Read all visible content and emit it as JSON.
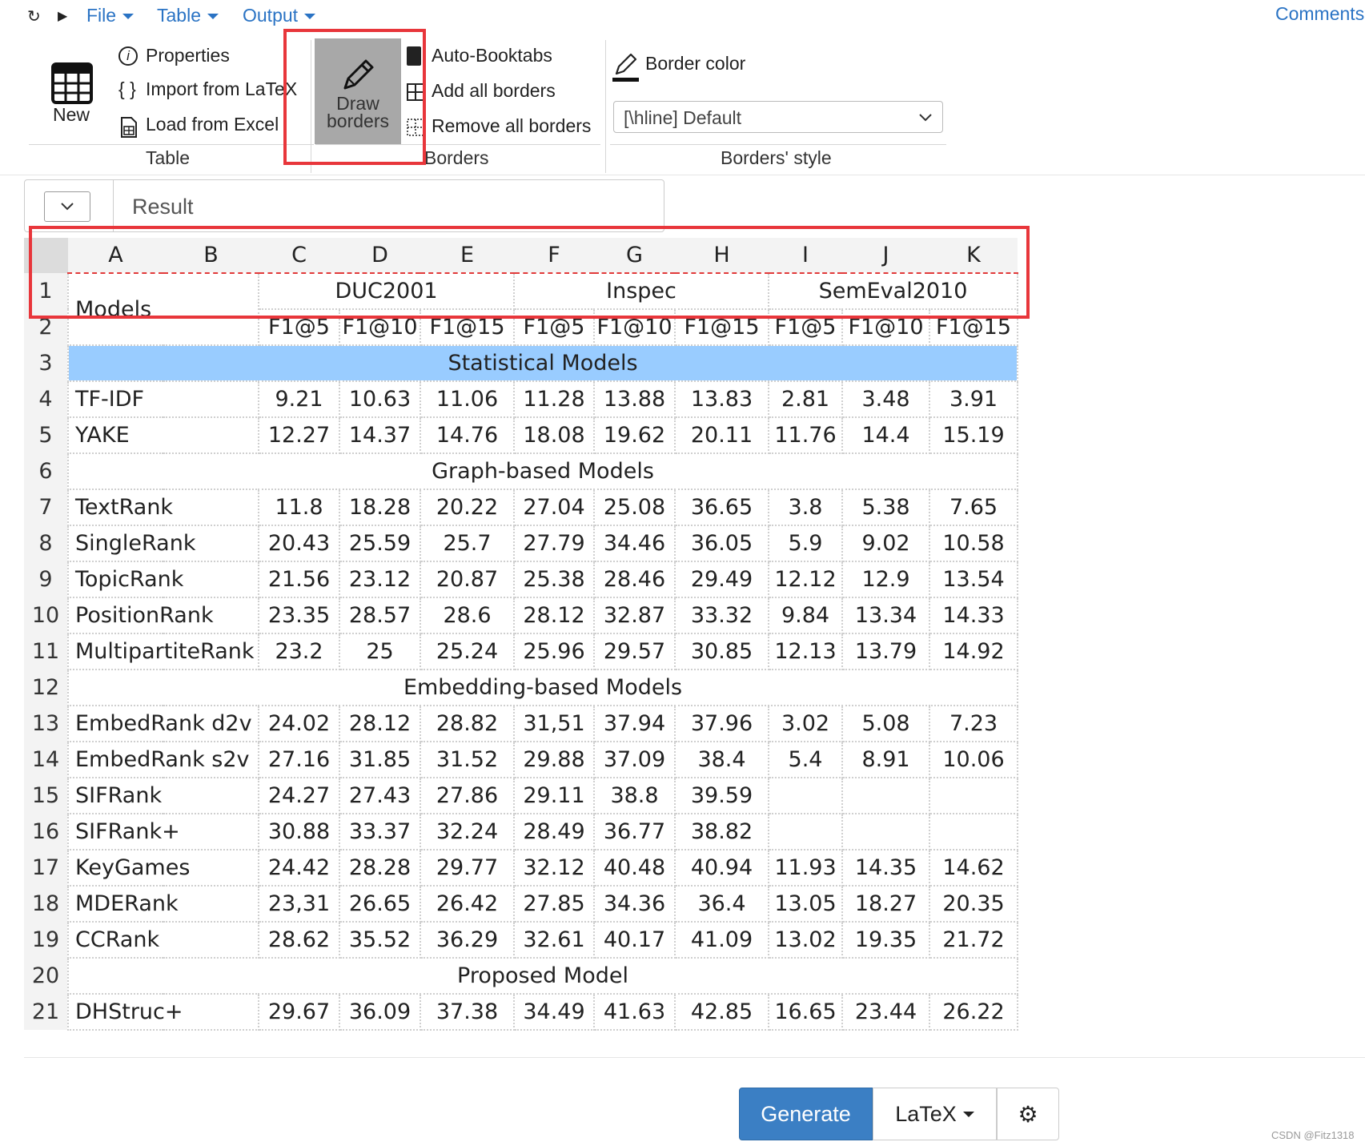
{
  "menu": {
    "file": "File",
    "table": "Table",
    "output": "Output",
    "comments": "Comments"
  },
  "ribbon": {
    "new_label": "New",
    "properties": "Properties",
    "import_latex": "Import from LaTeX",
    "load_excel": "Load from Excel",
    "group_table": "Table",
    "draw_borders_line1": "Draw",
    "draw_borders_line2": "borders",
    "auto_booktabs": "Auto-Booktabs",
    "add_all_borders": "Add all borders",
    "remove_all_borders": "Remove all borders",
    "group_borders": "Borders",
    "border_color": "Border color",
    "border_style_value": "[\\hline] Default",
    "group_borders_style": "Borders' style"
  },
  "result_bar": {
    "label": "Result"
  },
  "grid": {
    "columns": [
      "A",
      "B",
      "C",
      "D",
      "E",
      "F",
      "G",
      "H",
      "I",
      "J",
      "K"
    ],
    "header1": {
      "models": "Models",
      "duc": "DUC2001",
      "inspec": "Inspec",
      "semeval": "SemEval2010"
    },
    "header2": [
      "F1@5",
      "F1@10",
      "F1@15",
      "F1@5",
      "F1@10",
      "F1@15",
      "F1@5",
      "F1@10",
      "F1@15"
    ],
    "sections": {
      "r3": "Statistical Models",
      "r6": "Graph-based Models",
      "r12": "Embedding-based Models",
      "r20": "Proposed Model"
    },
    "data_rows": [
      {
        "row": "4",
        "name": "TF-IDF",
        "values": [
          "9.21",
          "10.63",
          "11.06",
          "11.28",
          "13.88",
          "13.83",
          "2.81",
          "3.48",
          "3.91"
        ]
      },
      {
        "row": "5",
        "name": "YAKE",
        "values": [
          "12.27",
          "14.37",
          "14.76",
          "18.08",
          "19.62",
          "20.11",
          "11.76",
          "14.4",
          "15.19"
        ]
      },
      {
        "row": "7",
        "name": "TextRank",
        "values": [
          "11.8",
          "18.28",
          "20.22",
          "27.04",
          "25.08",
          "36.65",
          "3.8",
          "5.38",
          "7.65"
        ]
      },
      {
        "row": "8",
        "name": "SingleRank",
        "values": [
          "20.43",
          "25.59",
          "25.7",
          "27.79",
          "34.46",
          "36.05",
          "5.9",
          "9.02",
          "10.58"
        ]
      },
      {
        "row": "9",
        "name": "TopicRank",
        "values": [
          "21.56",
          "23.12",
          "20.87",
          "25.38",
          "28.46",
          "29.49",
          "12.12",
          "12.9",
          "13.54"
        ]
      },
      {
        "row": "10",
        "name": "PositionRank",
        "values": [
          "23.35",
          "28.57",
          "28.6",
          "28.12",
          "32.87",
          "33.32",
          "9.84",
          "13.34",
          "14.33"
        ]
      },
      {
        "row": "11",
        "name": "MultipartiteRank",
        "values": [
          "23.2",
          "25",
          "25.24",
          "25.96",
          "29.57",
          "30.85",
          "12.13",
          "13.79",
          "14.92"
        ]
      },
      {
        "row": "13",
        "name": "EmbedRank d2v",
        "values": [
          "24.02",
          "28.12",
          "28.82",
          "31,51",
          "37.94",
          "37.96",
          "3.02",
          "5.08",
          "7.23"
        ]
      },
      {
        "row": "14",
        "name": "EmbedRank s2v",
        "values": [
          "27.16",
          "31.85",
          "31.52",
          "29.88",
          "37.09",
          "38.4",
          "5.4",
          "8.91",
          "10.06"
        ]
      },
      {
        "row": "15",
        "name": "SIFRank",
        "values": [
          "24.27",
          "27.43",
          "27.86",
          "29.11",
          "38.8",
          "39.59",
          "",
          "",
          ""
        ]
      },
      {
        "row": "16",
        "name": "SIFRank+",
        "values": [
          "30.88",
          "33.37",
          "32.24",
          "28.49",
          "36.77",
          "38.82",
          "",
          "",
          ""
        ]
      },
      {
        "row": "17",
        "name": "KeyGames",
        "values": [
          "24.42",
          "28.28",
          "29.77",
          "32.12",
          "40.48",
          "40.94",
          "11.93",
          "14.35",
          "14.62"
        ]
      },
      {
        "row": "18",
        "name": "MDERank",
        "values": [
          "23,31",
          "26.65",
          "26.42",
          "27.85",
          "34.36",
          "36.4",
          "13.05",
          "18.27",
          "20.35"
        ]
      },
      {
        "row": "19",
        "name": "CCRank",
        "values": [
          "28.62",
          "35.52",
          "36.29",
          "32.61",
          "40.17",
          "41.09",
          "13.02",
          "19.35",
          "21.72"
        ]
      },
      {
        "row": "21",
        "name": "DHStruc+",
        "values": [
          "29.67",
          "36.09",
          "37.38",
          "34.49",
          "41.63",
          "42.85",
          "16.65",
          "23.44",
          "26.22"
        ]
      }
    ],
    "section_colors": {
      "statistical": "#99ccff"
    }
  },
  "bottom": {
    "generate": "Generate",
    "format": "LaTeX",
    "settings_icon": "gear-icon"
  },
  "watermark": "CSDN @Fitz1318"
}
